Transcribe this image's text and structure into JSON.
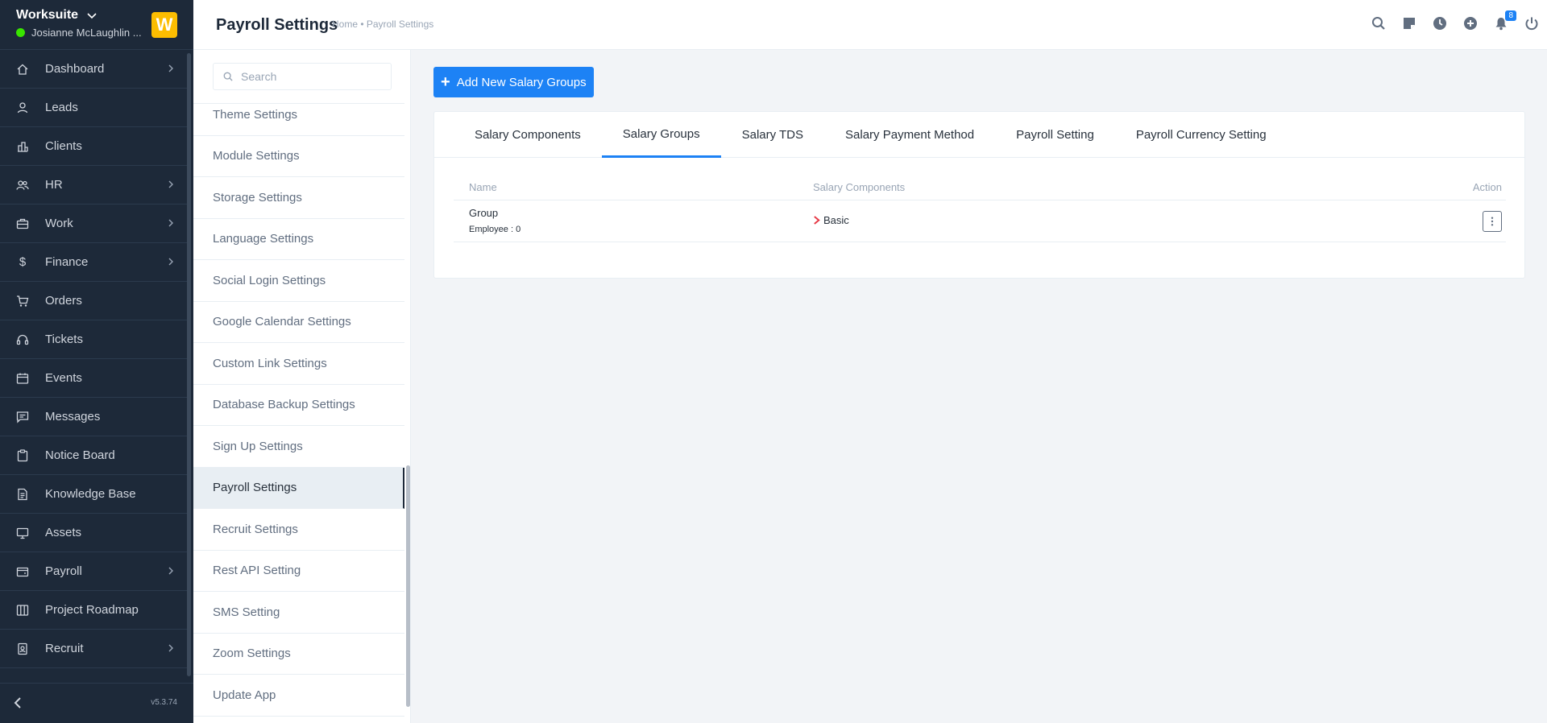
{
  "brand": {
    "name": "Worksuite",
    "user": "Josianne McLaughlin ...",
    "logo_letter": "W",
    "logo_color": "#fcbd01",
    "status_color": "#39e500"
  },
  "sidebar": {
    "items": [
      {
        "label": "Dashboard",
        "icon": "house-icon",
        "has_arrow": true
      },
      {
        "label": "Leads",
        "icon": "person-icon",
        "has_arrow": false
      },
      {
        "label": "Clients",
        "icon": "building-icon",
        "has_arrow": false
      },
      {
        "label": "HR",
        "icon": "people-icon",
        "has_arrow": true
      },
      {
        "label": "Work",
        "icon": "briefcase-icon",
        "has_arrow": true
      },
      {
        "label": "Finance",
        "icon": "dollar-icon",
        "has_arrow": true
      },
      {
        "label": "Orders",
        "icon": "cart-icon",
        "has_arrow": false
      },
      {
        "label": "Tickets",
        "icon": "headset-icon",
        "has_arrow": false
      },
      {
        "label": "Events",
        "icon": "calendar-icon",
        "has_arrow": false
      },
      {
        "label": "Messages",
        "icon": "chat-icon",
        "has_arrow": false
      },
      {
        "label": "Notice Board",
        "icon": "clipboard-icon",
        "has_arrow": false
      },
      {
        "label": "Knowledge Base",
        "icon": "document-icon",
        "has_arrow": false
      },
      {
        "label": "Assets",
        "icon": "monitor-icon",
        "has_arrow": false
      },
      {
        "label": "Payroll",
        "icon": "wallet-icon",
        "has_arrow": true
      },
      {
        "label": "Project Roadmap",
        "icon": "columns-icon",
        "has_arrow": false
      },
      {
        "label": "Recruit",
        "icon": "badge-icon",
        "has_arrow": true
      }
    ],
    "version": "v5.3.74"
  },
  "header": {
    "title": "Payroll Settings",
    "breadcrumb": "Home • Payroll Settings",
    "notification_count": "8",
    "accent_color": "#1d82f5"
  },
  "settings_nav": {
    "search_placeholder": "Search",
    "items": [
      "Theme Settings",
      "Module Settings",
      "Storage Settings",
      "Language Settings",
      "Social Login Settings",
      "Google Calendar Settings",
      "Custom Link Settings",
      "Database Backup Settings",
      "Sign Up Settings",
      "Payroll Settings",
      "Recruit Settings",
      "Rest API Setting",
      "SMS Setting",
      "Zoom Settings",
      "Update App"
    ],
    "active": "Payroll Settings"
  },
  "main": {
    "add_button_label": "Add New Salary Groups",
    "tabs": [
      "Salary Components",
      "Salary Groups",
      "Salary TDS",
      "Salary Payment Method",
      "Payroll Setting",
      "Payroll Currency Setting"
    ],
    "active_tab": "Salary Groups",
    "table": {
      "headers": {
        "name": "Name",
        "components": "Salary Components",
        "action": "Action"
      },
      "rows": [
        {
          "name": "Group",
          "employees": "Employee : 0",
          "component": "Basic"
        }
      ]
    }
  }
}
